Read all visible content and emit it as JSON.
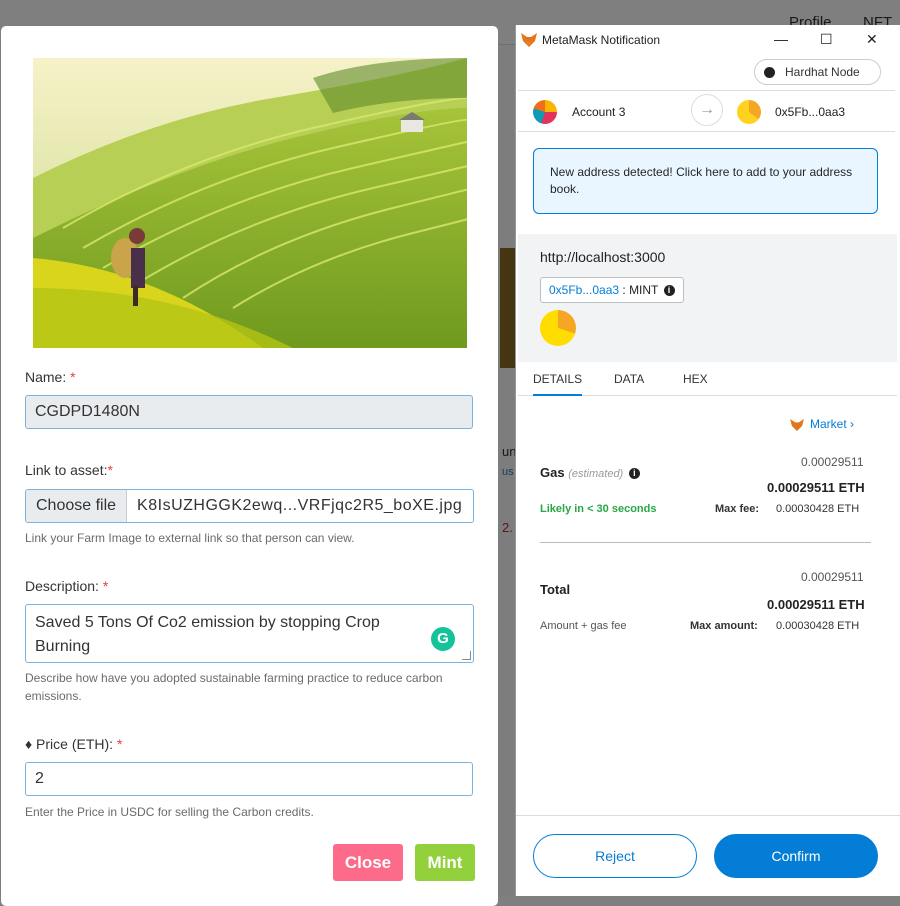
{
  "background": {
    "nav": [
      "Profile",
      "NFT"
    ],
    "snippet": [
      "un",
      "us",
      "2."
    ]
  },
  "form": {
    "name_label": "Name:",
    "name_value": "CGDPD1480N",
    "link_label": "Link to asset:",
    "file_button": "Choose file",
    "file_name": "K8IsUZHGGK2ewq...VRFjqc2R5_boXE.jpg",
    "link_help": "Link your Farm Image to external link so that person can view.",
    "desc_label": "Description:",
    "desc_value": "Saved 5 Tons Of Co2 emission by stopping Crop Burning",
    "desc_help": "Describe how have you adopted sustainable farming practice to reduce carbon emissions.",
    "price_label": "Price (ETH):",
    "price_value": "2",
    "price_help": "Enter the Price in USDC for selling the Carbon credits.",
    "required_mark": "*",
    "close_button": "Close",
    "mint_button": "Mint"
  },
  "metamask": {
    "window_title": "MetaMask Notification",
    "network": "Hardhat Node",
    "from_account": "Account 3",
    "to_address": "0x5Fb...0aa3",
    "alert": "New address detected! Click here to add to your address book.",
    "origin": "http://localhost:3000",
    "method_address": "0x5Fb...0aa3",
    "method_name": " : MINT",
    "tabs": [
      "DETAILS",
      "DATA",
      "HEX"
    ],
    "market": "Market",
    "gas_label": "Gas",
    "gas_estimated": "(estimated)",
    "gas_value": "0.00029511",
    "gas_eth": "0.00029511 ETH",
    "likely": "Likely in < 30 seconds",
    "max_fee_label": "Max fee:",
    "max_fee_value": "0.00030428 ETH",
    "total_label": "Total",
    "total_value": "0.00029511",
    "total_eth": "0.00029511 ETH",
    "amount_gas": "Amount + gas fee",
    "max_amount_label": "Max amount:",
    "max_amount_value": "0.00030428 ETH",
    "reject": "Reject",
    "confirm": "Confirm"
  },
  "icons": [
    "metamask-fox-icon",
    "minimize-icon",
    "maximize-icon",
    "close-icon",
    "arrow-right-icon",
    "info-icon",
    "chevron-right-icon",
    "grammarly-icon",
    "ethereum-icon"
  ],
  "colors": {
    "accent": "#037dd6",
    "close": "#fd6b8a",
    "mint": "#92d13c",
    "green": "#28a745"
  }
}
